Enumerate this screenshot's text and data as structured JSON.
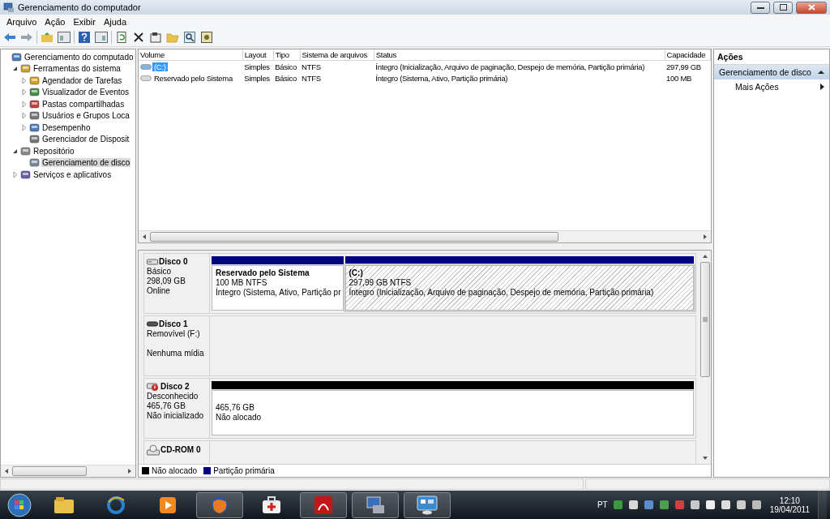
{
  "window": {
    "title": "Gerenciamento do computador"
  },
  "menu": [
    "Arquivo",
    "Ação",
    "Exibir",
    "Ajuda"
  ],
  "tree": [
    {
      "label": "Gerenciamento do computado",
      "selected": false,
      "children": [
        {
          "label": "Ferramentas do sistema",
          "selected": false,
          "expanded": true,
          "children": [
            {
              "label": "Agendador de Tarefas",
              "selected": false,
              "expanded": false
            },
            {
              "label": "Visualizador de Eventos",
              "selected": false,
              "expanded": false
            },
            {
              "label": "Pastas compartilhadas",
              "selected": false,
              "expanded": false
            },
            {
              "label": "Usuários e Grupos Loca",
              "selected": false,
              "expanded": false
            },
            {
              "label": "Desempenho",
              "selected": false,
              "expanded": false
            },
            {
              "label": "Gerenciador de Disposit",
              "selected": false
            }
          ]
        },
        {
          "label": "Repositório",
          "selected": false,
          "expanded": true,
          "children": [
            {
              "label": "Gerenciamento de disco",
              "selected": true
            }
          ]
        },
        {
          "label": "Serviços e aplicativos",
          "selected": false,
          "expanded": false
        }
      ]
    }
  ],
  "table": {
    "columns": [
      "Volume",
      "Layout",
      "Tipo",
      "Sistema de arquivos",
      "Status",
      "Capacidade"
    ],
    "rows": [
      {
        "volume": "(C:)",
        "layout": "Simples",
        "tipo": "Básico",
        "filesystem": "NTFS",
        "status": "Íntegro (Inicialização, Arquivo de paginação, Despejo de memória, Partição primária)",
        "capacity": "297,99 GB",
        "selected": true
      },
      {
        "volume": "Reservado pelo Sistema",
        "layout": "Simples",
        "tipo": "Básico",
        "filesystem": "NTFS",
        "status": "Íntegro (Sistema, Ativo, Partição primária)",
        "capacity": "100 MB",
        "selected": false
      }
    ]
  },
  "disks": [
    {
      "name": "Disco 0",
      "kind": "hdd",
      "type": "Básico",
      "size": "298,09 GB",
      "status": "Online",
      "partitions": [
        {
          "title": "Reservado pelo Sistema",
          "lines": [
            "100 MB NTFS",
            "Íntegro (Sistema, Ativo, Partição pr"
          ],
          "color": "#000080",
          "selected": false
        },
        {
          "title": "(C:)",
          "lines": [
            "297,99 GB NTFS",
            "Íntegro (Inicialização, Arquivo de paginação, Despejo de memória, Partição primária)"
          ],
          "color": "#000080",
          "selected": true
        }
      ]
    },
    {
      "name": "Disco 1",
      "kind": "removable",
      "type": "Removível (F:)",
      "status": "Nenhuma mídia"
    },
    {
      "name": "Disco 2",
      "kind": "unknown",
      "type": "Desconhecido",
      "size": "465,76 GB",
      "status": "Não inicializado",
      "partitions": [
        {
          "lines": [
            "465,76 GB",
            "Não alocado"
          ],
          "color": "#000000",
          "selected": false
        }
      ]
    },
    {
      "name": "CD-ROM 0",
      "kind": "cdrom"
    }
  ],
  "legend": [
    {
      "label": "Não alocado",
      "color": "#000000"
    },
    {
      "label": "Partição primária",
      "color": "#000080"
    }
  ],
  "actions": {
    "title": "Ações",
    "section": {
      "label": "Gerenciamento de disco",
      "expanded": true
    },
    "items": [
      "Mais Ações"
    ]
  },
  "tray": {
    "language": "PT",
    "time": "12:10",
    "date": "19/04/2011"
  }
}
